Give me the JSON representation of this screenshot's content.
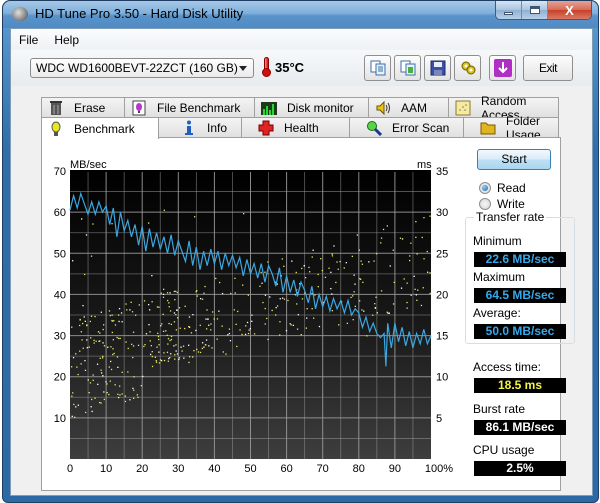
{
  "window": {
    "title": "HD Tune Pro 3.50 - Hard Disk Utility",
    "close_glyph": "X"
  },
  "menu": [
    "File",
    "Help"
  ],
  "toolbar": {
    "drive": "WDC WD1600BEVT-22ZCT (160 GB)",
    "temperature": "35°C",
    "icons": [
      "copy-text-icon",
      "copy-screenshot-icon",
      "save-icon",
      "options-icon",
      "download-icon"
    ],
    "exit_label": "Exit"
  },
  "tabs": {
    "row1": [
      {
        "label": "Erase",
        "icon": "trash-icon"
      },
      {
        "label": "File Benchmark",
        "icon": "file-benchmark-icon"
      },
      {
        "label": "Disk monitor",
        "icon": "disk-monitor-icon"
      },
      {
        "label": "AAM",
        "icon": "speaker-icon"
      },
      {
        "label": "Random Access",
        "icon": "random-access-icon"
      }
    ],
    "row2": [
      {
        "label": "Benchmark",
        "icon": "lightbulb-icon",
        "active": true
      },
      {
        "label": "Info",
        "icon": "info-icon"
      },
      {
        "label": "Health",
        "icon": "health-cross-icon"
      },
      {
        "label": "Error Scan",
        "icon": "magnifier-icon"
      },
      {
        "label": "Folder Usage",
        "icon": "folder-icon"
      }
    ]
  },
  "controls": {
    "start_label": "Start",
    "mode_options": [
      {
        "label": "Read",
        "selected": true
      },
      {
        "label": "Write",
        "selected": false
      }
    ]
  },
  "results": {
    "transfer_rate_title": "Transfer rate",
    "minimum_label": "Minimum",
    "minimum_value": "22.6 MB/sec",
    "maximum_label": "Maximum",
    "maximum_value": "64.5 MB/sec",
    "average_label": "Average:",
    "average_value": "50.0 MB/sec",
    "access_time_label": "Access time:",
    "access_time_value": "18.5 ms",
    "burst_rate_label": "Burst rate",
    "burst_rate_value": "86.1 MB/sec",
    "cpu_usage_label": "CPU usage",
    "cpu_usage_value": "2.5%"
  },
  "colors": {
    "read_line": "#3aa8e2",
    "access_points": "#e8e860",
    "plot_bg_top": "#000000",
    "plot_bg_bottom": "#3c3c3c",
    "grid": "#9a9a9a"
  },
  "chart_data": {
    "type": "line",
    "title": "",
    "ylabel_left": "MB/sec",
    "ylabel_right": "ms",
    "xlabel": "",
    "xlim": [
      0,
      100
    ],
    "ylim_left": [
      0,
      70
    ],
    "ylim_right": [
      0,
      35
    ],
    "x_ticks": [
      "0",
      "10",
      "20",
      "30",
      "40",
      "50",
      "60",
      "70",
      "80",
      "90",
      "100%"
    ],
    "y_ticks_left": [
      "10",
      "20",
      "30",
      "40",
      "50",
      "60",
      "70"
    ],
    "y_ticks_right": [
      "5",
      "10",
      "15",
      "20",
      "25",
      "30",
      "35"
    ],
    "grid": true,
    "series": [
      {
        "name": "Transfer rate (Read)",
        "axis": "left",
        "x": [
          0,
          1,
          2,
          3,
          4,
          5,
          6,
          7,
          8,
          9,
          10,
          11,
          12,
          13,
          14,
          15,
          16,
          17,
          18,
          19,
          20,
          21,
          22,
          23,
          24,
          25,
          26,
          27,
          28,
          29,
          30,
          31,
          32,
          33,
          34,
          35,
          36,
          37,
          38,
          39,
          40,
          41,
          42,
          43,
          44,
          45,
          46,
          47,
          48,
          49,
          50,
          51,
          52,
          53,
          54,
          55,
          56,
          57,
          58,
          59,
          60,
          61,
          62,
          63,
          64,
          65,
          66,
          67,
          68,
          69,
          70,
          71,
          72,
          73,
          74,
          75,
          76,
          77,
          78,
          79,
          80,
          81,
          82,
          83,
          84,
          85,
          86,
          87,
          87.5,
          88,
          89,
          90,
          91,
          92,
          93,
          94,
          95,
          96,
          97,
          98,
          99,
          100
        ],
        "values": [
          60.5,
          64,
          61,
          64.5,
          62,
          59.5,
          62.5,
          59.5,
          62.5,
          60,
          61.5,
          57,
          61,
          54,
          60,
          55.5,
          58,
          54,
          57,
          52,
          56.5,
          50.5,
          56,
          51.5,
          55,
          51,
          54,
          50,
          54.5,
          49.5,
          53,
          50.5,
          48,
          53,
          47,
          51.5,
          46,
          50.5,
          47,
          51,
          47.5,
          50.5,
          46,
          50,
          47,
          49.5,
          46.5,
          49,
          44.5,
          48.5,
          45,
          47.5,
          44,
          47.5,
          43,
          47,
          45,
          42,
          46.5,
          40.5,
          44.5,
          40.5,
          43.5,
          39.5,
          43,
          41,
          38,
          42,
          36.5,
          40,
          37,
          39.5,
          36,
          39,
          36.5,
          38.5,
          35.5,
          38.5,
          35,
          36.5,
          35.5,
          32,
          34.5,
          31,
          33,
          30.5,
          29.5,
          30.5,
          22.5,
          33,
          27,
          33,
          28.5,
          32,
          27.5,
          31,
          27,
          30.5,
          28,
          31.5,
          28,
          30
        ]
      },
      {
        "name": "Access time",
        "axis": "right",
        "type": "scatter",
        "x_range": [
          0,
          100
        ],
        "values_range_ms": [
          5,
          32
        ],
        "mean_ms": 18.5
      }
    ]
  }
}
